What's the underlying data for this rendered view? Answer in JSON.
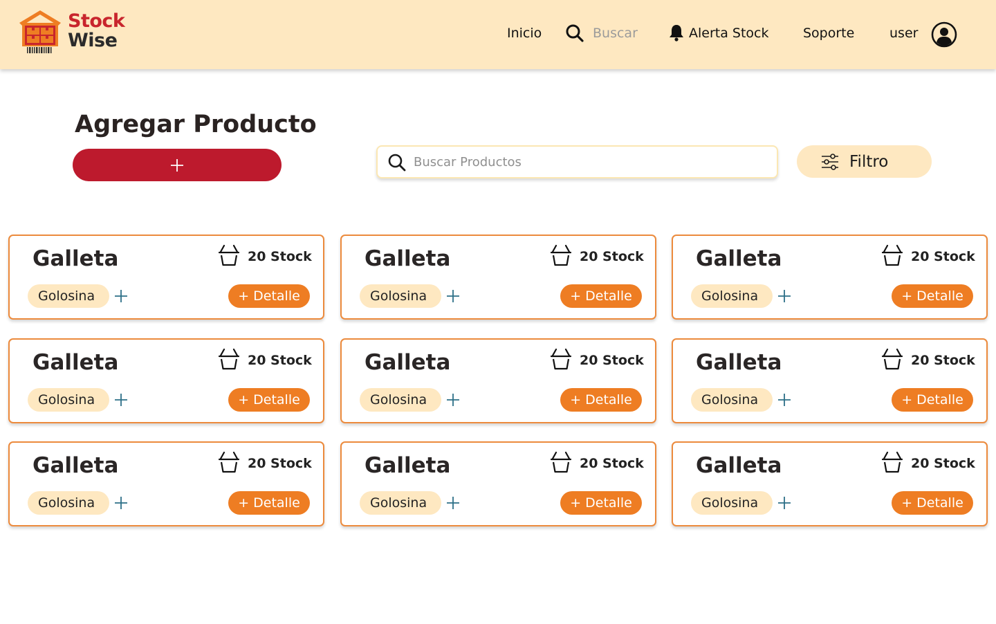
{
  "brand": {
    "line1": "Stock",
    "line2": "Wise"
  },
  "nav": {
    "home": "Inicio",
    "search": "Buscar",
    "alerts": "Alerta Stock",
    "support": "Soporte",
    "user": "user"
  },
  "page": {
    "title": "Agregar Producto",
    "add_label": "+",
    "search_placeholder": "Buscar Productos",
    "filter_label": "Filtro"
  },
  "colors": {
    "header_bg": "#fee8c1",
    "add_button": "#bd1a2d",
    "card_border": "#ec8a3c",
    "detail_button": "#ee7d23",
    "chip_bg": "#fee8c1"
  },
  "products": [
    {
      "name": "Galleta",
      "stock": "20 Stock",
      "category": "Golosina",
      "action": "+ Detalle"
    },
    {
      "name": "Galleta",
      "stock": "20 Stock",
      "category": "Golosina",
      "action": "+ Detalle"
    },
    {
      "name": "Galleta",
      "stock": "20 Stock",
      "category": "Golosina",
      "action": "+ Detalle"
    },
    {
      "name": "Galleta",
      "stock": "20 Stock",
      "category": "Golosina",
      "action": "+ Detalle"
    },
    {
      "name": "Galleta",
      "stock": "20 Stock",
      "category": "Golosina",
      "action": "+ Detalle"
    },
    {
      "name": "Galleta",
      "stock": "20 Stock",
      "category": "Golosina",
      "action": "+ Detalle"
    },
    {
      "name": "Galleta",
      "stock": "20 Stock",
      "category": "Golosina",
      "action": "+ Detalle"
    },
    {
      "name": "Galleta",
      "stock": "20 Stock",
      "category": "Golosina",
      "action": "+ Detalle"
    },
    {
      "name": "Galleta",
      "stock": "20 Stock",
      "category": "Golosina",
      "action": "+ Detalle"
    }
  ]
}
